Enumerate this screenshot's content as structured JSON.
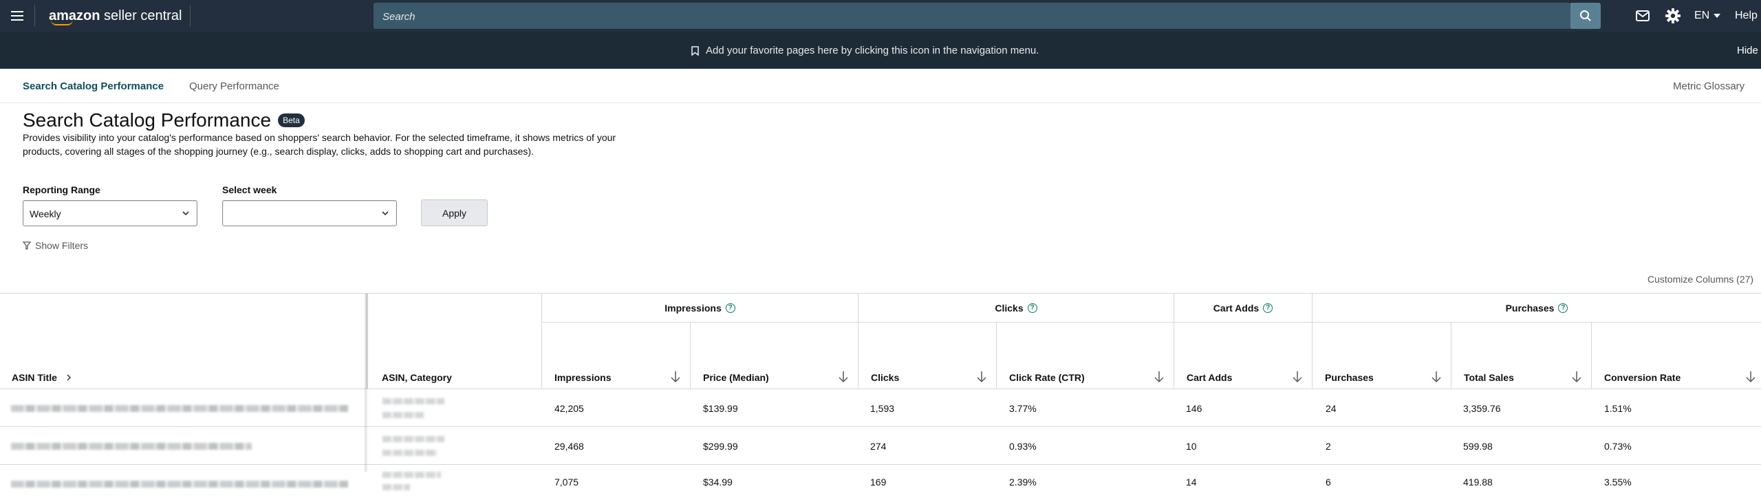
{
  "topbar": {
    "brand_prefix": "amazon",
    "brand_suffix": "seller central",
    "search_placeholder": "Search",
    "language": "EN",
    "help": "Help",
    "icons": [
      "menu-icon",
      "search-icon",
      "mail-icon",
      "gear-icon",
      "caret-down-icon"
    ]
  },
  "favbar": {
    "message": "Add your favorite pages here by clicking this icon in the navigation menu.",
    "hide": "Hide"
  },
  "subnav": {
    "tabs": [
      {
        "label": "Search Catalog Performance",
        "active": true
      },
      {
        "label": "Query Performance",
        "active": false
      }
    ],
    "glossary": "Metric Glossary"
  },
  "page": {
    "title": "Search Catalog Performance",
    "badge": "Beta",
    "description": "Provides visibility into your catalog's performance based on shoppers' search behavior. For the selected timeframe, it shows metrics of your products, covering all stages of the shopping journey (e.g., search display, clicks, adds to shopping cart and purchases)."
  },
  "controls": {
    "range_label": "Reporting Range",
    "range_value": "Weekly",
    "week_label": "Select week",
    "week_value": "",
    "apply": "Apply",
    "show_filters": "Show Filters",
    "customize": "Customize Columns (27)"
  },
  "table": {
    "groups": [
      {
        "label": "Impressions"
      },
      {
        "label": "Clicks"
      },
      {
        "label": "Cart Adds"
      },
      {
        "label": "Purchases"
      }
    ],
    "columns": {
      "asin_title": "ASIN Title",
      "asin_category": "ASIN, Category",
      "impressions": "Impressions",
      "price": "Price (Median)",
      "clicks": "Clicks",
      "ctr": "Click Rate (CTR)",
      "cart_adds": "Cart Adds",
      "purchases": "Purchases",
      "total_sales": "Total Sales",
      "conversion": "Conversion Rate"
    },
    "rows": [
      {
        "impressions": "42,205",
        "price": "$139.99",
        "clicks": "1,593",
        "ctr": "3.77%",
        "cart_adds": "146",
        "purchases": "24",
        "total_sales": "3,359.76",
        "conversion": "1.51%"
      },
      {
        "impressions": "29,468",
        "price": "$299.99",
        "clicks": "274",
        "ctr": "0.93%",
        "cart_adds": "10",
        "purchases": "2",
        "total_sales": "599.98",
        "conversion": "0.73%"
      },
      {
        "impressions": "7,075",
        "price": "$34.99",
        "clicks": "169",
        "ctr": "2.39%",
        "cart_adds": "14",
        "purchases": "6",
        "total_sales": "419.88",
        "conversion": "3.55%"
      }
    ]
  },
  "colors": {
    "topbar": "#232f3e",
    "search": "#3a5a6c",
    "accent": "#067d62",
    "brand_smile": "#ff9900"
  }
}
